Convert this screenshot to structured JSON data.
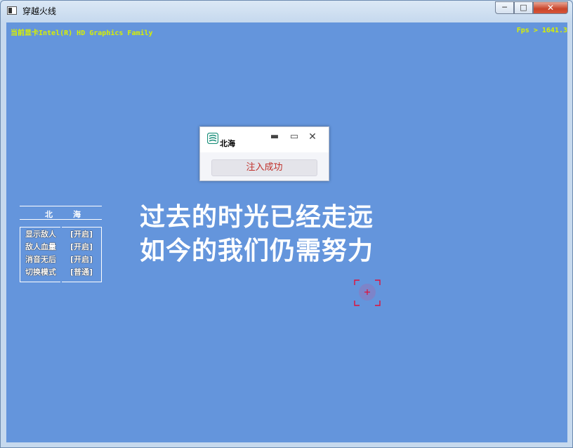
{
  "window": {
    "title": "穿越火线",
    "min_label": "─",
    "max_label": "□",
    "close_label": "✕"
  },
  "hud": {
    "gpu": "当前显卡Intel(R) HD Graphics Family",
    "fps": "Fps > 1641.3"
  },
  "popup": {
    "title": "北海",
    "min_label": "▬",
    "max_label": "▭",
    "close_label": "✕",
    "status_button": "注入成功"
  },
  "menu": {
    "title_left": "北",
    "title_right": "海",
    "items": [
      {
        "label": "显示敌人",
        "value": "[开启]"
      },
      {
        "label": "敌人血量",
        "value": "[开启]"
      },
      {
        "label": "消音无后",
        "value": "[开启]"
      },
      {
        "label": "切换模式",
        "value": "[普通]"
      }
    ]
  },
  "slogan": {
    "line1": "过去的时光已经走远",
    "line2": "如今的我们仍需努力"
  },
  "colors": {
    "game_bg": "#6495dc",
    "hud_text": "#d8f000",
    "crosshair": "#e0103a",
    "status_text": "#c0302a"
  },
  "icons": {
    "app": "window-app-icon",
    "popup_logo": "beihai-logo-icon",
    "crosshair": "crosshair-icon"
  }
}
